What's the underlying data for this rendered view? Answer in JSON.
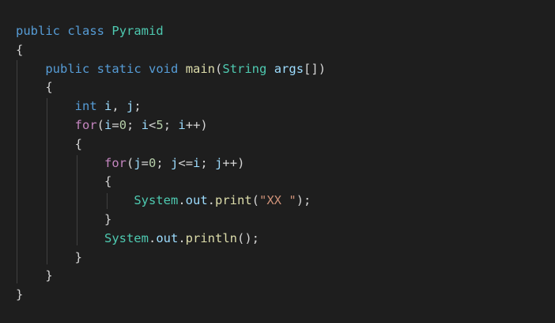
{
  "colors": {
    "background": "#1e1e1e",
    "keyword": "#569cd6",
    "control": "#c586c0",
    "function": "#dcdcaa",
    "class": "#4ec9b0",
    "variable": "#9cdcfe",
    "number": "#b5cea8",
    "string": "#ce9178",
    "plain": "#d4d4d4"
  },
  "code": {
    "l1": {
      "kw1": "public",
      "kw2": "class",
      "cls": "Pyramid"
    },
    "l2": {
      "p": "{"
    },
    "l3": {
      "kw1": "public",
      "kw2": "static",
      "kw3": "void",
      "fn": "main",
      "p1": "(",
      "cls": "String",
      "var": "args",
      "p2": "[])"
    },
    "l4": {
      "p": "{"
    },
    "l5": {
      "kw": "int",
      "var1": "i",
      "p1": ", ",
      "var2": "j",
      "p2": ";"
    },
    "l6": {
      "ctl": "for",
      "p1": "(",
      "v1": "i",
      "p2": "=",
      "n1": "0",
      "p3": "; ",
      "v2": "i",
      "p4": "<",
      "n2": "5",
      "p5": "; ",
      "v3": "i",
      "p6": "++)"
    },
    "l7": {
      "p": "{"
    },
    "l8": {
      "ctl": "for",
      "p1": "(",
      "v1": "j",
      "p2": "=",
      "n1": "0",
      "p3": "; ",
      "v2": "j",
      "p4": "<=",
      "v3": "i",
      "p5": "; ",
      "v4": "j",
      "p6": "++)"
    },
    "l9": {
      "p": "{"
    },
    "l10": {
      "cls": "System",
      "p1": ".",
      "var": "out",
      "p2": ".",
      "fn": "print",
      "p3": "(",
      "str": "\"XX \"",
      "p4": ");"
    },
    "l11": {
      "p": "}"
    },
    "l12": {
      "cls": "System",
      "p1": ".",
      "var": "out",
      "p2": ".",
      "fn": "println",
      "p3": "();"
    },
    "l13": {
      "p": "}"
    },
    "l14": {
      "p": "}"
    },
    "l15": {
      "p": "}"
    }
  }
}
